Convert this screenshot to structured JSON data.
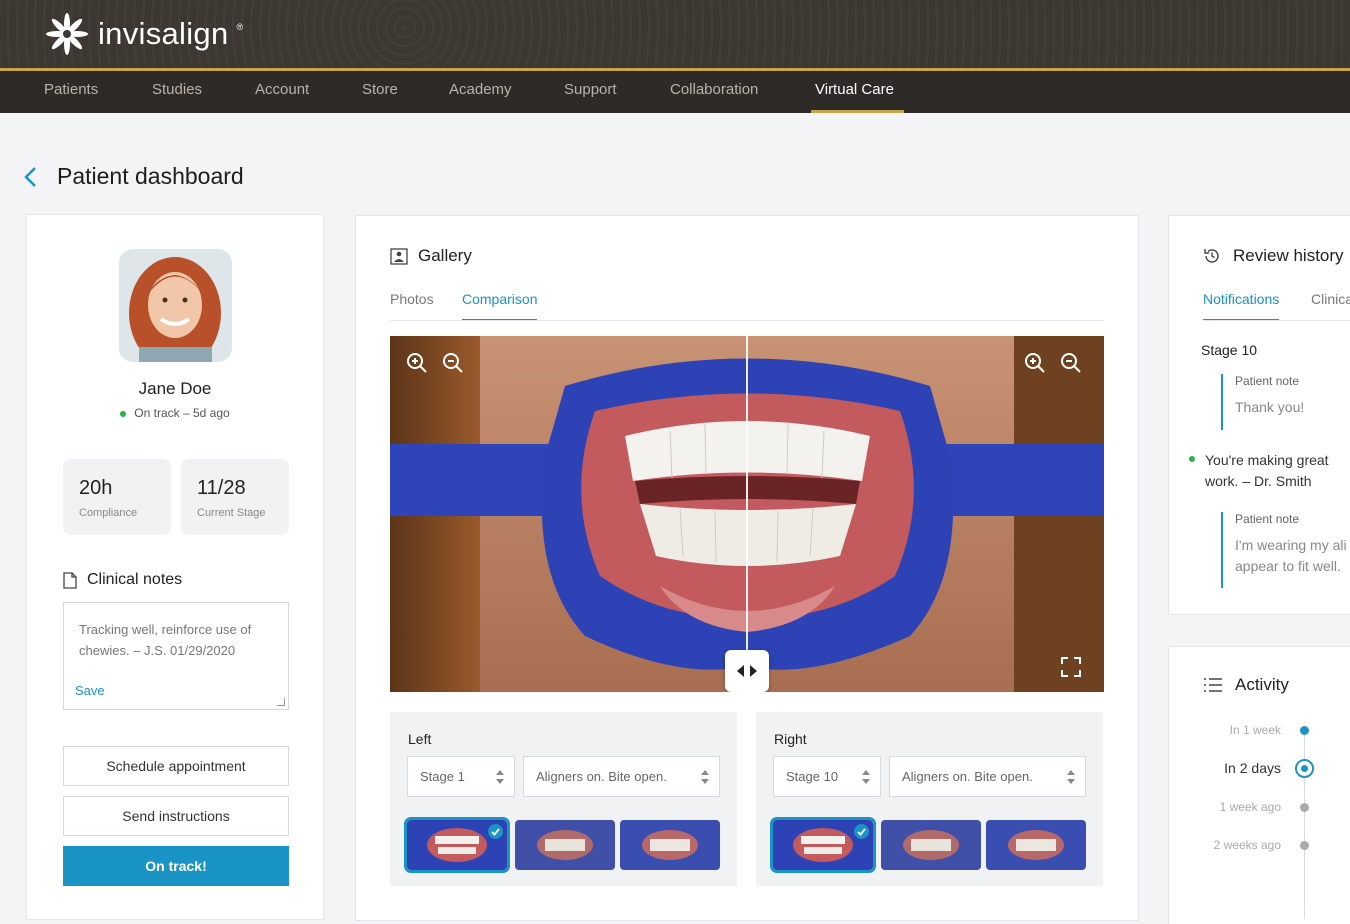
{
  "brand": {
    "name": "invisalign",
    "reg": "®"
  },
  "nav": {
    "items": [
      {
        "label": "Patients"
      },
      {
        "label": "Studies"
      },
      {
        "label": "Account"
      },
      {
        "label": "Store"
      },
      {
        "label": "Academy"
      },
      {
        "label": "Support"
      },
      {
        "label": "Collaboration"
      },
      {
        "label": "Virtual Care"
      }
    ],
    "active": "Virtual Care"
  },
  "page": {
    "title": "Patient dashboard"
  },
  "patient": {
    "name": "Jane Doe",
    "status": "On track – 5d ago",
    "stats": [
      {
        "value": "20h",
        "label": "Compliance"
      },
      {
        "value": "11/28",
        "label": "Current Stage"
      }
    ],
    "clinical_notes": {
      "title": "Clinical notes",
      "text": "Tracking well, reinforce use of chewies. – J.S. 01/29/2020",
      "save_label": "Save"
    },
    "actions": {
      "schedule": "Schedule appointment",
      "send": "Send instructions",
      "on_track": "On track!"
    }
  },
  "gallery": {
    "title": "Gallery",
    "tabs": [
      {
        "label": "Photos"
      },
      {
        "label": "Comparison"
      }
    ],
    "active_tab": "Comparison",
    "left": {
      "label": "Left",
      "stage": "Stage 1",
      "view": "Aligners on. Bite open."
    },
    "right": {
      "label": "Right",
      "stage": "Stage 10",
      "view": "Aligners on. Bite open."
    }
  },
  "review_history": {
    "title": "Review history",
    "tabs": [
      {
        "label": "Notifications"
      },
      {
        "label": "Clinica"
      }
    ],
    "stage": "Stage 10",
    "notes": [
      {
        "label": "Patient note",
        "line1": "Thank you!",
        "line2": ""
      },
      {
        "label": "Patient note",
        "line1": "I'm wearing my ali",
        "line2": "appear to fit well."
      }
    ],
    "message": {
      "line1": "You're making great",
      "line2": "work. – Dr. Smith"
    }
  },
  "activity": {
    "title": "Activity",
    "timeline": [
      {
        "label": "In 1 week"
      },
      {
        "label": "In 2 days"
      },
      {
        "label": "1 week ago"
      },
      {
        "label": "2 weeks ago"
      }
    ]
  },
  "colors": {
    "accent": "#1a93c5",
    "gold": "#c9a54a",
    "header": "#3d3732",
    "nav": "#2e2a27",
    "success": "#2bb24c"
  }
}
